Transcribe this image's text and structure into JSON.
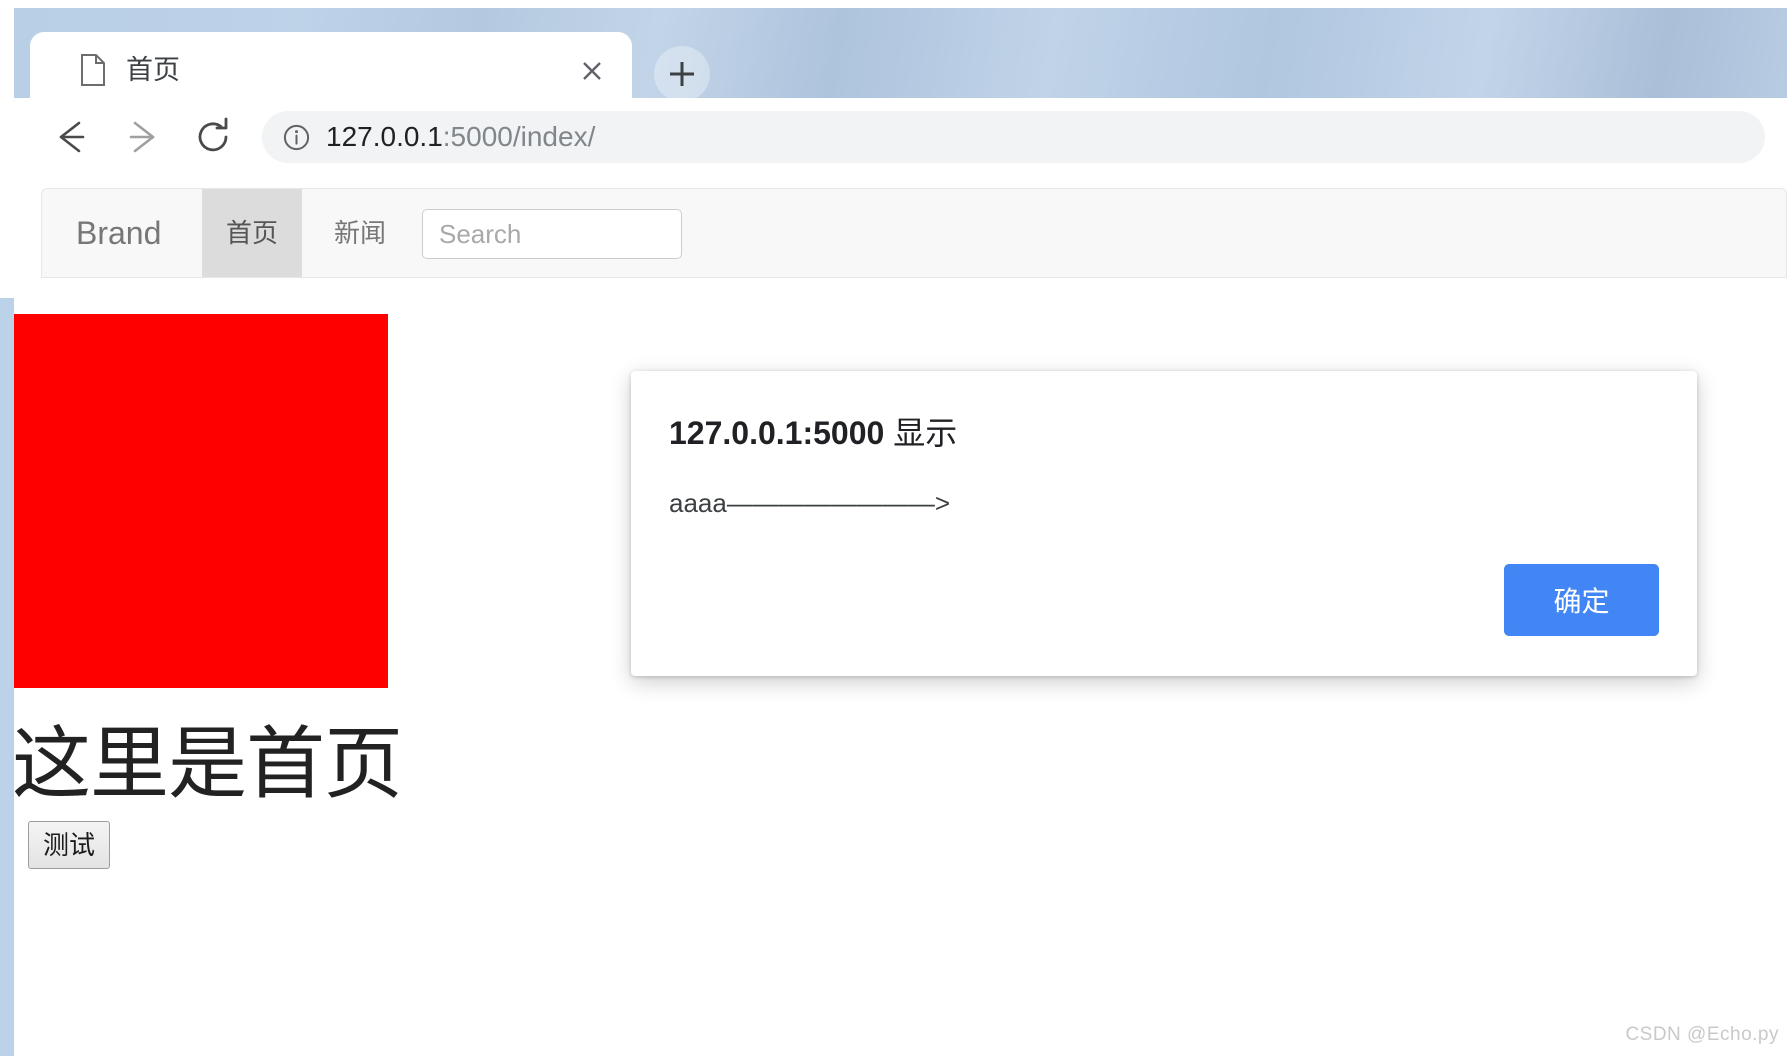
{
  "browser": {
    "tab": {
      "title": "首页",
      "favicon_icon": "page-document-icon",
      "close_icon": "close-icon"
    },
    "new_tab_icon": "plus-icon",
    "toolbar": {
      "back_icon": "arrow-left-icon",
      "forward_icon": "arrow-right-icon",
      "reload_icon": "reload-icon",
      "site_info_icon": "info-circle-icon",
      "url_host": "127.0.0.1",
      "url_rest": ":5000/index/",
      "url_full": "127.0.0.1:5000/index/"
    }
  },
  "navbar": {
    "brand": "Brand",
    "links": [
      {
        "label": "首页",
        "active": true
      },
      {
        "label": "新闻",
        "active": false
      }
    ],
    "search": {
      "placeholder": "Search",
      "value": ""
    }
  },
  "page": {
    "red_box_color": "#ff0000",
    "heading": "这里是首页",
    "test_button_label": "测试"
  },
  "dialog": {
    "host": "127.0.0.1:5000",
    "verb": "显示",
    "message": "aaaa————————>",
    "ok_label": "确定",
    "ok_color": "#4285f4"
  },
  "watermark": {
    "text": "CSDN @Echo.py"
  }
}
